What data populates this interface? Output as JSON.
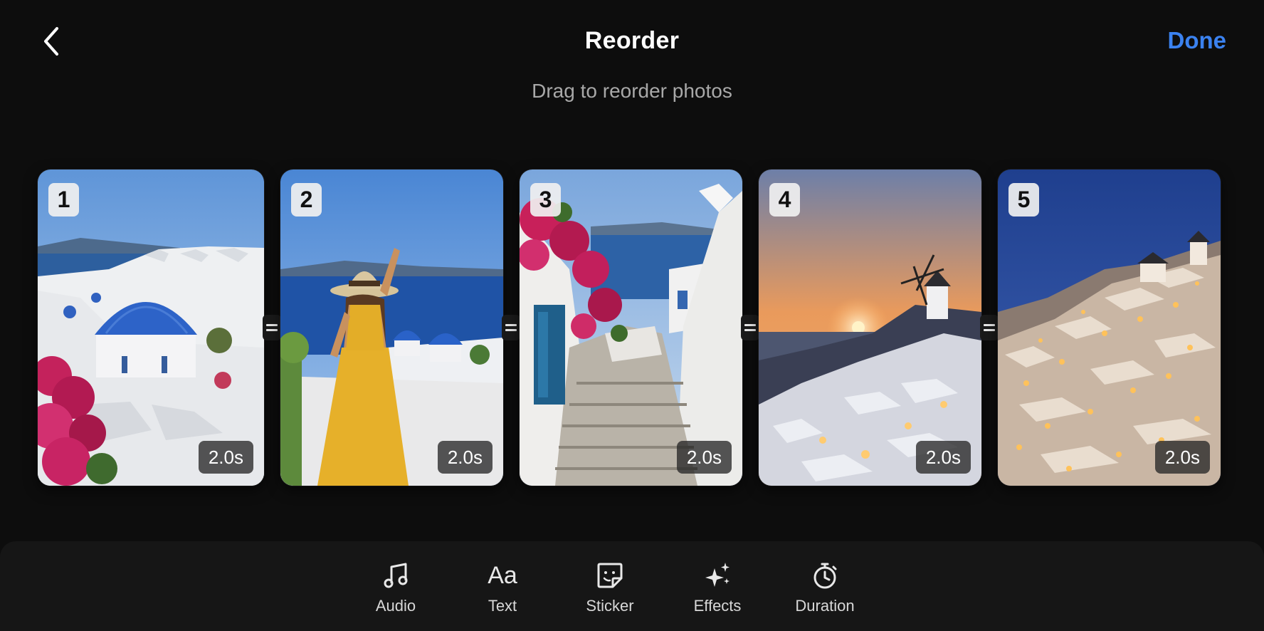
{
  "header": {
    "title": "Reorder",
    "done_label": "Done",
    "subtitle": "Drag to reorder photos",
    "back_icon": "chevron-left-icon",
    "accent_color": "#3b82f0"
  },
  "photos": [
    {
      "number": "1",
      "duration": "2.0s",
      "scene": "blue-dome-church"
    },
    {
      "number": "2",
      "duration": "2.0s",
      "scene": "woman-in-yellow-dress"
    },
    {
      "number": "3",
      "duration": "2.0s",
      "scene": "alley-with-bougainvillea"
    },
    {
      "number": "4",
      "duration": "2.0s",
      "scene": "windmill-sunset"
    },
    {
      "number": "5",
      "duration": "2.0s",
      "scene": "village-at-dusk"
    }
  ],
  "toolbar": {
    "items": [
      {
        "label": "Audio",
        "icon": "music-note-icon"
      },
      {
        "label": "Text",
        "icon": "text-aa-icon",
        "glyph": "Aa"
      },
      {
        "label": "Sticker",
        "icon": "sticker-icon"
      },
      {
        "label": "Effects",
        "icon": "sparkles-icon"
      },
      {
        "label": "Duration",
        "icon": "stopwatch-icon"
      }
    ]
  }
}
